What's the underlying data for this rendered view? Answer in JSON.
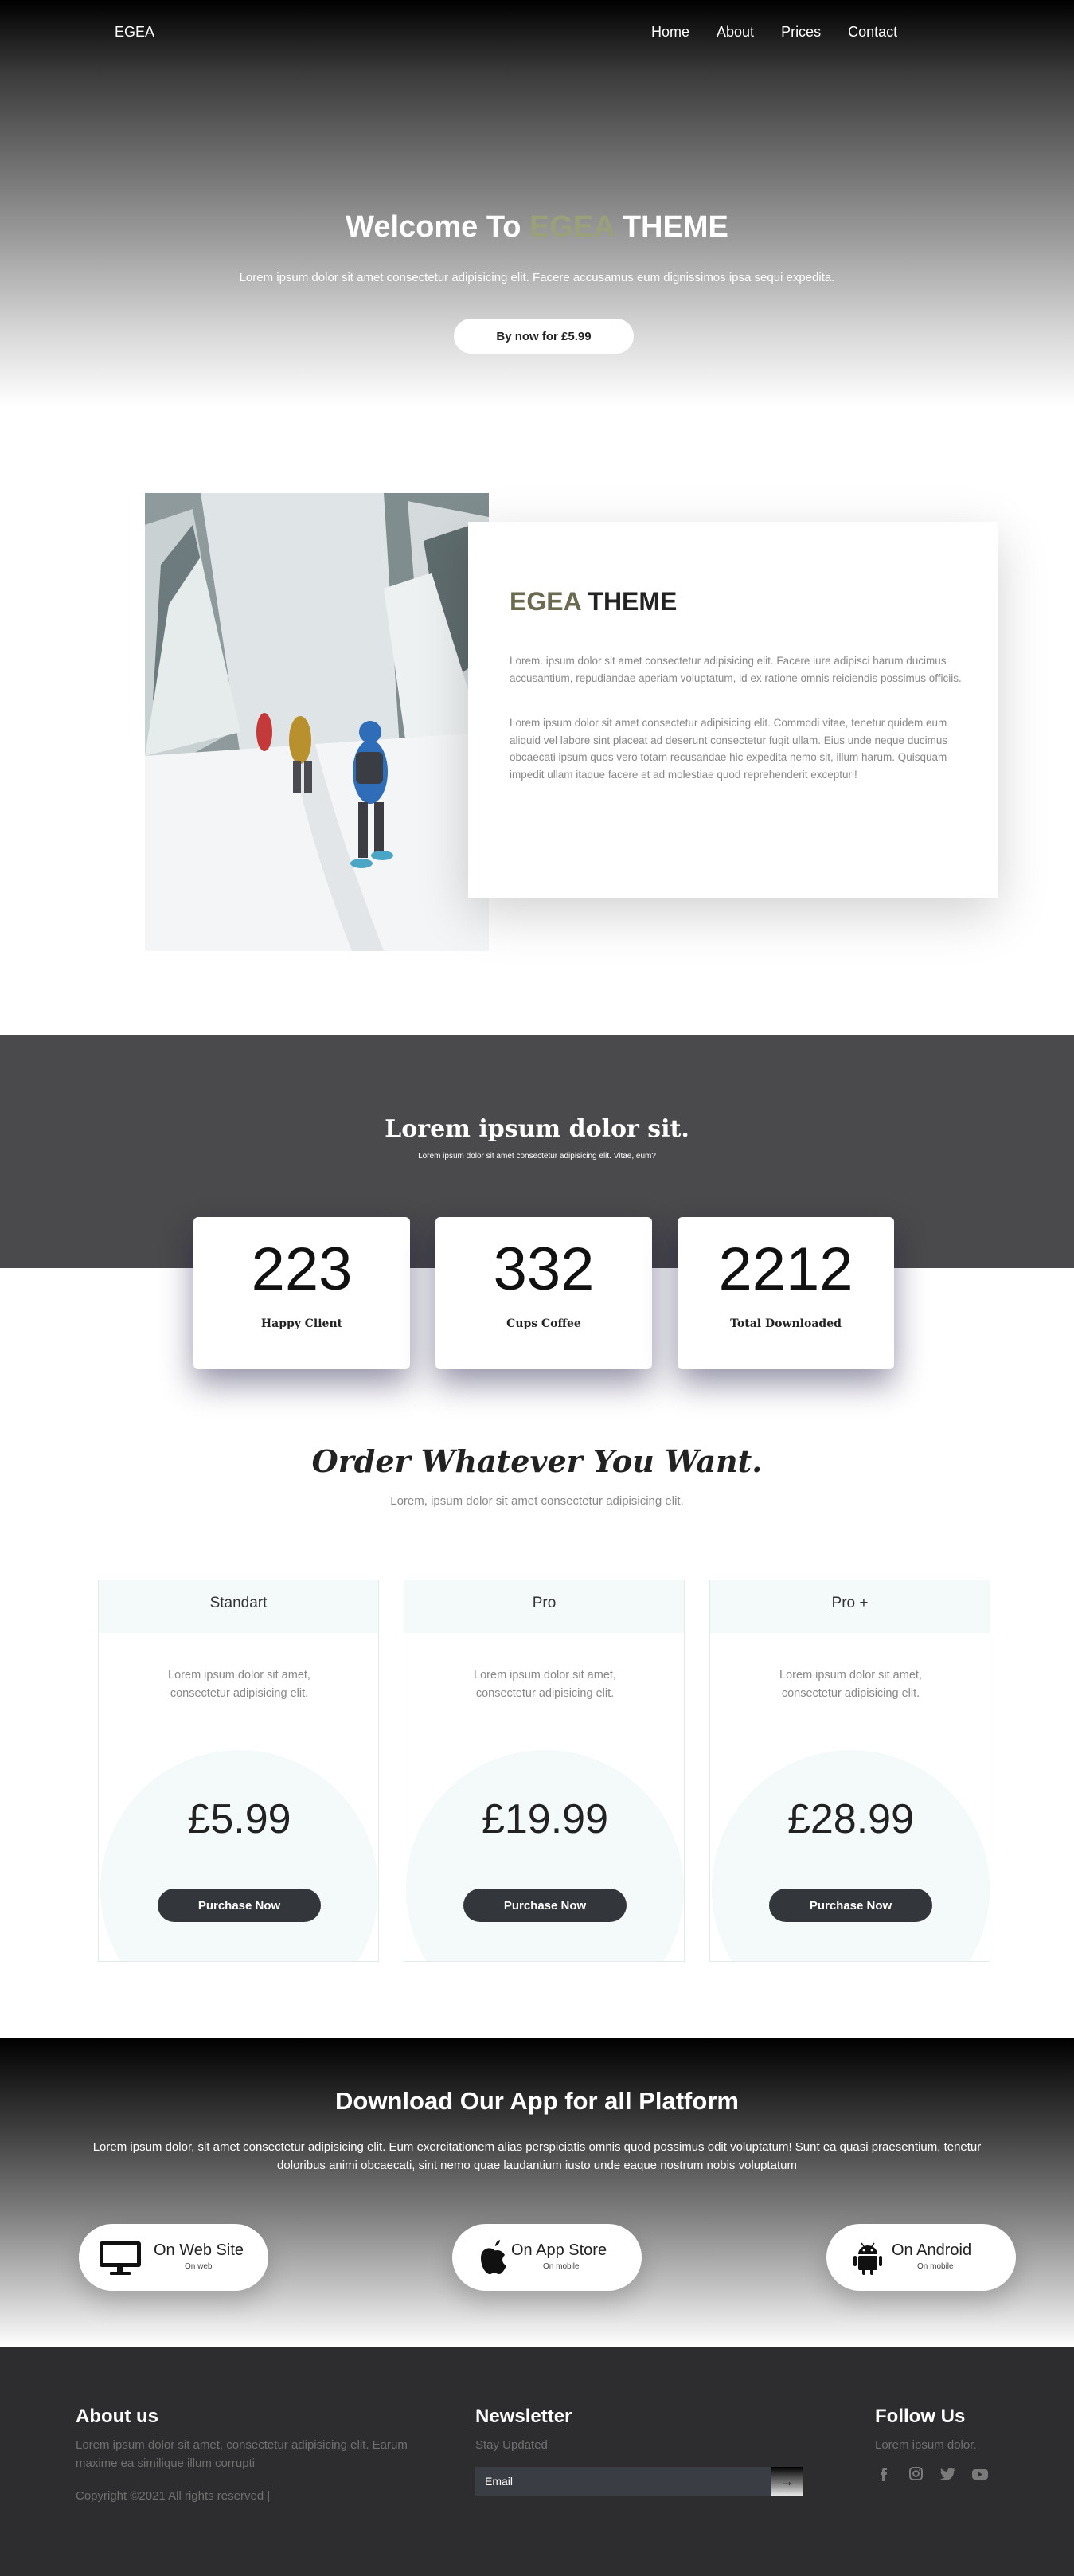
{
  "nav": {
    "brand": "EGEA",
    "links": [
      "Home",
      "About",
      "Prices",
      "Contact"
    ]
  },
  "hero": {
    "title_pre": "Welcome To ",
    "title_accent": "EGEA",
    "title_post": " THEME",
    "subtitle": "Lorem ipsum dolor sit amet consectetur adipisicing elit. Facere accusamus eum dignissimos ipsa sequi expedita.",
    "button": "By now for £5.99"
  },
  "about": {
    "title_accent": "EGEA",
    "title_rest": " THEME",
    "paragraph1": "Lorem. ipsum dolor sit amet consectetur adipisicing elit. Facere iure adipisci harum ducimus accusantium, repudiandae aperiam voluptatum, id ex ratione omnis reiciendis possimus officiis.",
    "paragraph2": "Lorem ipsum dolor sit amet consectetur adipisicing elit. Commodi vitae, tenetur quidem eum aliquid vel labore sint placeat ad deserunt consectetur fugit ullam. Eius unde neque ducimus obcaecati ipsum quos vero totam recusandae hic expedita nemo sit, illum harum. Quisquam impedit ullam itaque facere et ad molestiae quod reprehenderit excepturi!"
  },
  "stats": {
    "title": "Lorem ipsum dolor sit.",
    "subtitle": "Lorem ipsum dolor sit amet consectetur adipisicing elit. Vitae, eum?",
    "items": [
      {
        "number": "223",
        "label": "Happy Client"
      },
      {
        "number": "332",
        "label": "Cups Coffee"
      },
      {
        "number": "2212",
        "label": "Total Downloaded"
      }
    ]
  },
  "pricing": {
    "title": "Order Whatever You Want.",
    "subtitle": "Lorem, ipsum dolor sit amet consectetur adipisicing elit.",
    "plans": [
      {
        "name": "Standart",
        "desc": "Lorem ipsum dolor sit amet, consectetur adipisicing elit.",
        "price": "£5.99",
        "button": "Purchase Now"
      },
      {
        "name": "Pro",
        "desc": "Lorem ipsum dolor sit amet, consectetur adipisicing elit.",
        "price": "£19.99",
        "button": "Purchase Now"
      },
      {
        "name": "Pro +",
        "desc": "Lorem ipsum dolor sit amet, consectetur adipisicing elit.",
        "price": "£28.99",
        "button": "Purchase Now"
      }
    ]
  },
  "download": {
    "title": "Download Our App for all Platform",
    "text": "Lorem ipsum dolor, sit amet consectetur adipisicing elit. Eum exercitationem alias perspiciatis omnis quod possimus odit voluptatum! Sunt ea quasi praesentium, tenetur doloribus animi obcaecati, sint nemo quae laudantium iusto unde eaque nostrum nobis voluptatum",
    "apps": [
      {
        "name": "On Web Site",
        "sub": "On web",
        "icon": "monitor-icon"
      },
      {
        "name": "On App Store",
        "sub": "On mobile",
        "icon": "apple-icon"
      },
      {
        "name": "On Android",
        "sub": "On mobile",
        "icon": "android-icon"
      }
    ]
  },
  "footer": {
    "about_title": "About us",
    "about_text": "Lorem ipsum dolor sit amet, consectetur adipisicing elit. Earum maxime ea similique illum corrupti",
    "copyright": "Copyright ©2021 All rights reserved |",
    "newsletter_title": "Newsletter",
    "newsletter_sub": "Stay Updated",
    "email_placeholder": "Email",
    "submit_icon": "arrow-right-icon",
    "follow_title": "Follow Us",
    "follow_text": "Lorem ipsum dolor.",
    "social_icons": [
      "facebook-icon",
      "instagram-icon",
      "twitter-icon",
      "youtube-icon"
    ]
  },
  "colors": {
    "accent_olive": "#9aa07a",
    "dark_button": "#33363a",
    "stats_band": "#4a4a4c",
    "footer_bg": "#2d2d2f",
    "price_tint": "#f4f9f9"
  }
}
